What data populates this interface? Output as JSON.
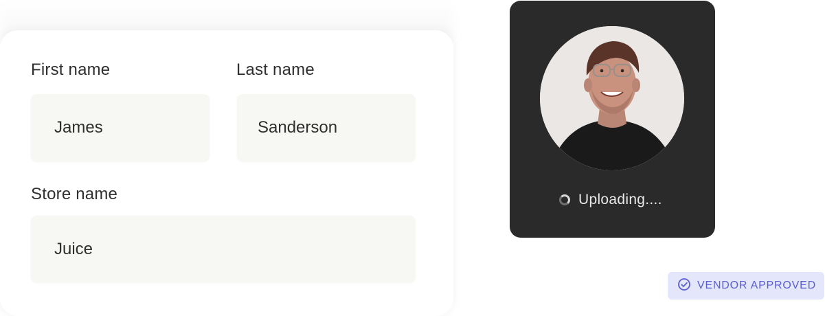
{
  "form": {
    "first_name": {
      "label": "First name",
      "value": "James"
    },
    "last_name": {
      "label": "Last name",
      "value": "Sanderson"
    },
    "store_name": {
      "label": "Store name",
      "value": "Juice"
    }
  },
  "upload": {
    "avatar_icon": "profile-photo",
    "spinner_icon": "loading-spinner-icon",
    "status_text": "Uploading...."
  },
  "badge": {
    "icon": "check-circle-icon",
    "text": "VENDOR APPROVED",
    "color": "#5a5fd1",
    "background": "#e4e6fb"
  }
}
